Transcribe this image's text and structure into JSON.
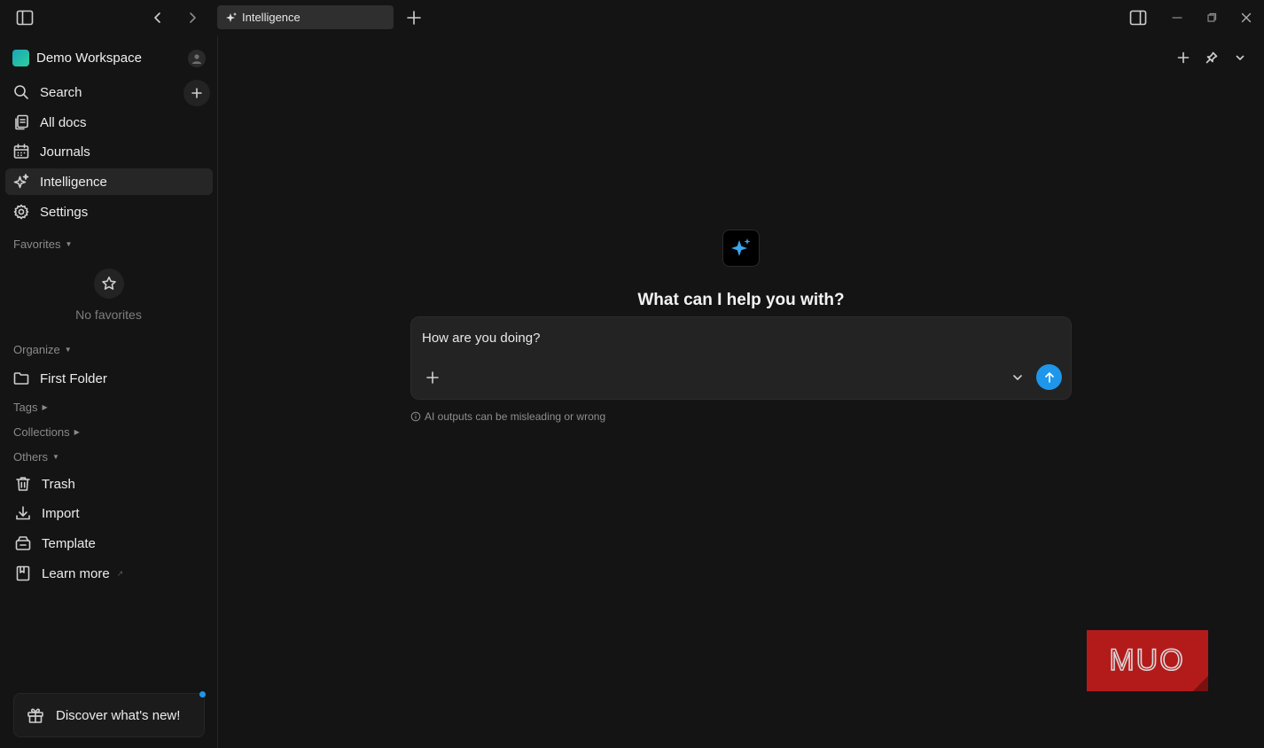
{
  "titlebar": {
    "tab_label": "Intelligence"
  },
  "workspace": {
    "name": "Demo Workspace"
  },
  "sidebar": {
    "nav": [
      {
        "label": "Search",
        "icon": "search-icon"
      },
      {
        "label": "All docs",
        "icon": "docs-icon"
      },
      {
        "label": "Journals",
        "icon": "calendar-icon"
      },
      {
        "label": "Intelligence",
        "icon": "sparkle-icon",
        "active": true
      },
      {
        "label": "Settings",
        "icon": "gear-icon"
      }
    ],
    "favorites_label": "Favorites",
    "no_favorites": "No favorites",
    "organize_label": "Organize",
    "folder": "First Folder",
    "tags_label": "Tags",
    "collections_label": "Collections",
    "others_label": "Others",
    "others": [
      {
        "label": "Trash",
        "icon": "trash-icon"
      },
      {
        "label": "Import",
        "icon": "download-icon"
      },
      {
        "label": "Template",
        "icon": "template-icon"
      },
      {
        "label": "Learn more",
        "icon": "book-icon"
      }
    ],
    "discover": "Discover what's new!"
  },
  "main": {
    "heading": "What can I help you with?",
    "input_value": "How are you doing?",
    "disclaimer": "AI outputs can be misleading or wrong"
  },
  "watermark": {
    "text": "MUO"
  },
  "colors": {
    "accent": "#1e96eb",
    "background": "#141414",
    "panel": "#232323",
    "watermark": "#b31b1b"
  }
}
